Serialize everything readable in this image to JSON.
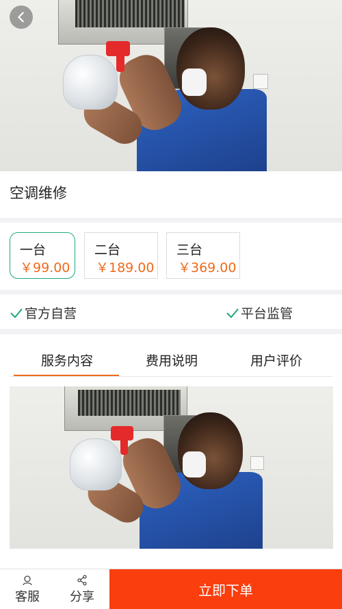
{
  "header": {
    "back_icon": "chevron-left-icon"
  },
  "product": {
    "title": "空调维修"
  },
  "options": [
    {
      "name": "一台",
      "price": "￥99.00",
      "selected": true
    },
    {
      "name": "二台",
      "price": "￥189.00",
      "selected": false
    },
    {
      "name": "三台",
      "price": "￥369.00",
      "selected": false
    }
  ],
  "guarantees": [
    {
      "icon": "check-icon",
      "label": "官方自营"
    },
    {
      "icon": "check-icon",
      "label": "平台监管"
    }
  ],
  "tabs": [
    {
      "label": "服务内容",
      "active": true
    },
    {
      "label": "费用说明",
      "active": false
    },
    {
      "label": "用户评价",
      "active": false
    }
  ],
  "bottom_bar": {
    "service": {
      "icon": "customer-service-icon",
      "label": "客服"
    },
    "share": {
      "icon": "share-icon",
      "label": "分享"
    },
    "order_label": "立即下单"
  },
  "colors": {
    "accent": "#ef6a1a",
    "selected_border": "#1ea87e",
    "order_button": "#fb3e0d",
    "check": "#1ea87e"
  }
}
